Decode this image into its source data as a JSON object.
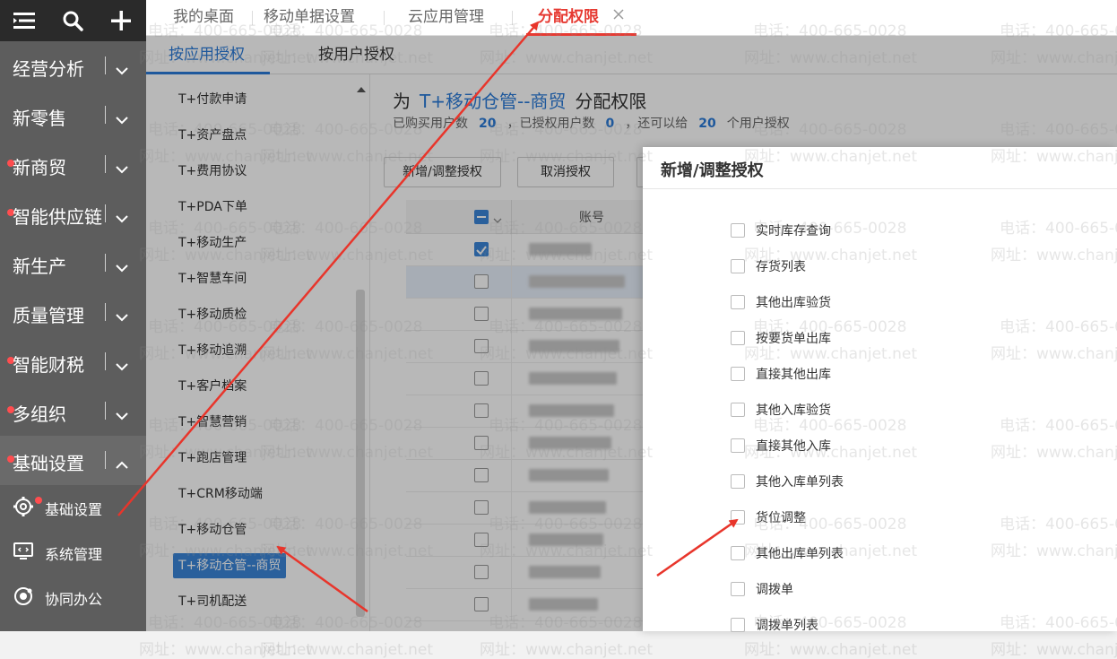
{
  "sidebar": {
    "top_icons": [
      "menu-icon",
      "search-icon",
      "plus-icon"
    ],
    "items": [
      {
        "label": "经营分析",
        "dot": false
      },
      {
        "label": "新零售",
        "dot": false
      },
      {
        "label": "新商贸",
        "dot": true
      },
      {
        "label": "智能供应链",
        "dot": true
      },
      {
        "label": "新生产",
        "dot": false
      },
      {
        "label": "质量管理",
        "dot": false
      },
      {
        "label": "智能财税",
        "dot": true
      },
      {
        "label": "多组织",
        "dot": true
      },
      {
        "label": "基础设置",
        "dot": true
      }
    ],
    "sub_items": [
      {
        "label": "基础设置",
        "icon": "gear-icon"
      },
      {
        "label": "系统管理",
        "icon": "monitor-icon"
      },
      {
        "label": "协同办公",
        "icon": "sync-icon"
      }
    ]
  },
  "tabs": [
    "我的桌面",
    "移动单据设置",
    "云应用管理",
    "分配权限"
  ],
  "active_tab": "分配权限",
  "subtabs": [
    "按应用授权",
    "按用户授权"
  ],
  "app_list": [
    "T+付款申请",
    "T+资产盘点",
    "T+费用协议",
    "T+PDA下单",
    "T+移动生产",
    "T+智慧车间",
    "T+移动质检",
    "T+移动追溯",
    "T+客户档案",
    "T+智慧营销",
    "T+跑店管理",
    "T+CRM移动端",
    "T+移动仓管",
    "T+移动仓管--商贸",
    "T+司机配送"
  ],
  "selected_app": "T+移动仓管--商贸",
  "assign": {
    "prefix": "为",
    "app": "T+移动仓管--商贸",
    "suffix": "分配权限",
    "stat_bought": "已购买用户数",
    "bought": "20",
    "stat_assigned": "，已授权用户数",
    "assigned": "0",
    "stat_remain": "，还可以给",
    "remain": "20",
    "stat_unit": "个用户授权"
  },
  "buttons": {
    "add": "新增/调整授权",
    "cancel": "取消授权"
  },
  "table": {
    "account_header": "账号",
    "rows": 12,
    "checked_row": 0,
    "highlight_row": 1
  },
  "modal": {
    "title": "新增/调整授权",
    "permissions": [
      "实时库存查询",
      "存货列表",
      "其他出库验货",
      "按要货单出库",
      "直接其他出库",
      "其他入库验货",
      "直接其他入库",
      "其他入库单列表",
      "货位调整",
      "其他出库单列表",
      "调拨单",
      "调拨单列表"
    ]
  },
  "watermark": {
    "phone": "电话：400-665-0028",
    "site": "网址：www.chanjet.net"
  },
  "colors": {
    "accent": "#2a7bd8",
    "active_tab": "#e63a32",
    "arrow": "#e8352b",
    "dot": "#ff4d4f"
  }
}
